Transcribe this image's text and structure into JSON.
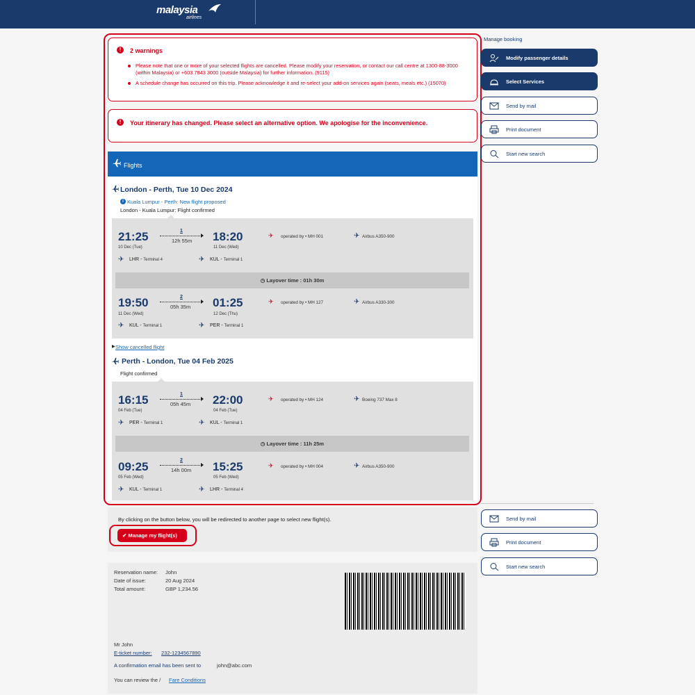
{
  "header": {
    "logo_text": "malaysia",
    "logo_sub": "airlines"
  },
  "warnings": {
    "title": "2 warnings",
    "items": [
      "Please note that one or more of your selected flights are cancelled. Please modify your reservation, or contact our call centre at 1300-88-3000 (within Malaysia) or +603 7843 3000 (outside Malaysia) for further information. (9115)",
      "A schedule change has occurred on this trip. Please acknowledge it and re-select your add-on services again (seats, meals etc.) (15070)"
    ]
  },
  "itinerary_alert": "Your itinerary has changed. Please select an alternative option. We apologise for the inconvenience.",
  "flights_label": "Flights",
  "outbound": {
    "title": "London - Perth, Tue 10 Dec 2024",
    "notice": "Kuala Lumpur - Perth: New flight proposed",
    "status": "London - Kuala Lumpur: Flight confirmed",
    "segments": [
      {
        "dep_time": "21:25",
        "dep_date": "10 Dec (Tue)",
        "stops": "1",
        "duration": "12h 55m",
        "arr_time": "18:20",
        "arr_date": "11 Dec (Wed)",
        "operated": "operated by",
        "flight": "MH 001",
        "aircraft": "Airbus A350-900",
        "dep_code": "LHR -",
        "dep_term": "Terminal 4",
        "arr_code": "KUL -",
        "arr_term": "Terminal 1"
      },
      {
        "dep_time": "19:50",
        "dep_date": "11 Dec (Wed)",
        "stops": "2",
        "duration": "05h 35m",
        "arr_time": "01:25",
        "arr_date": "12 Dec (Thu)",
        "operated": "operated by",
        "flight": "MH 127",
        "aircraft": "Airbus A330-300",
        "dep_code": "KUL -",
        "dep_term": "Terminal 1",
        "arr_code": "PER -",
        "arr_term": "Terminal 1"
      }
    ],
    "layover": "Layover time : 01h 30m",
    "show_cancelled": "Show cancelled flight"
  },
  "inbound": {
    "title": "Perth - London, Tue 04 Feb 2025",
    "status": "Flight confirmed",
    "segments": [
      {
        "dep_time": "16:15",
        "dep_date": "04 Feb (Tue)",
        "stops": "1",
        "duration": "05h 45m",
        "arr_time": "22:00",
        "arr_date": "04 Feb (Tue)",
        "operated": "operated by",
        "flight": "MH 124",
        "aircraft": "Boeing 737 Max 8",
        "dep_code": "PER -",
        "dep_term": "Terminal 1",
        "arr_code": "KUL -",
        "arr_term": "Terminal 1"
      },
      {
        "dep_time": "09:25",
        "dep_date": "05 Feb (Wed)",
        "stops": "2",
        "duration": "14h 00m",
        "arr_time": "15:25",
        "arr_date": "05 Feb (Wed)",
        "operated": "operated by",
        "flight": "MH 004",
        "aircraft": "Airbus A350-900",
        "dep_code": "KUL -",
        "dep_term": "Terminal 1",
        "arr_code": "LHR -",
        "arr_term": "Terminal 4"
      }
    ],
    "layover": "Layover time : 11h 25m"
  },
  "cta": {
    "text": "By clicking on the button below, you will be redirected to another page to select new flight(s).",
    "button": "Manage my flight(s)"
  },
  "reservation": {
    "name_label": "Reservation name:",
    "name": "John",
    "date_label": "Date of issue:",
    "date": "20 Aug 2024",
    "total_label": "Total amount:",
    "total": "GBP 1,234.56",
    "passenger": "Mr John",
    "ticket_label": "E-ticket number:",
    "ticket": "232-1234567890",
    "email_text": "A confirmation email has been sent to",
    "email": "john@abc.com",
    "fare_prefix": "You can review the /",
    "fare_link": "Fare Conditions"
  },
  "sidebar": {
    "heading": "Manage booking",
    "buttons": [
      "Modify passenger details",
      "Select Services",
      "Send by mail",
      "Print document",
      "Start new search"
    ],
    "lower_buttons": [
      "Send by mail",
      "Print document",
      "Start new search"
    ]
  },
  "colors": {
    "brand": "#1a3a6b",
    "alert": "#d4001a",
    "accent": "#1467b8"
  }
}
